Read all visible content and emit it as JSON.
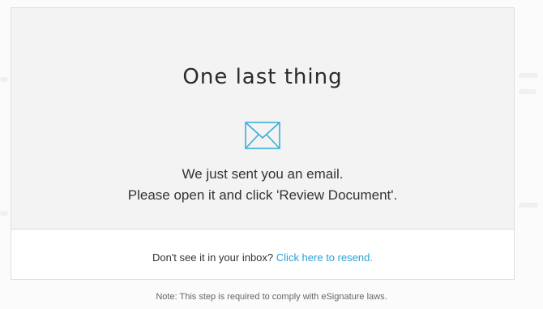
{
  "dialog": {
    "title": "One last thing",
    "icon": "envelope-icon",
    "message_line1": "We just sent you an email.",
    "message_line2": "Please open it and click 'Review Document'.",
    "resend_prompt": "Don't see it in your inbox?",
    "resend_link": "Click here to resend."
  },
  "note": "Note: This step is required to comply with eSignature laws.",
  "colors": {
    "accent": "#2a9fd6",
    "panel": "#f3f3f3",
    "text": "#333333"
  }
}
